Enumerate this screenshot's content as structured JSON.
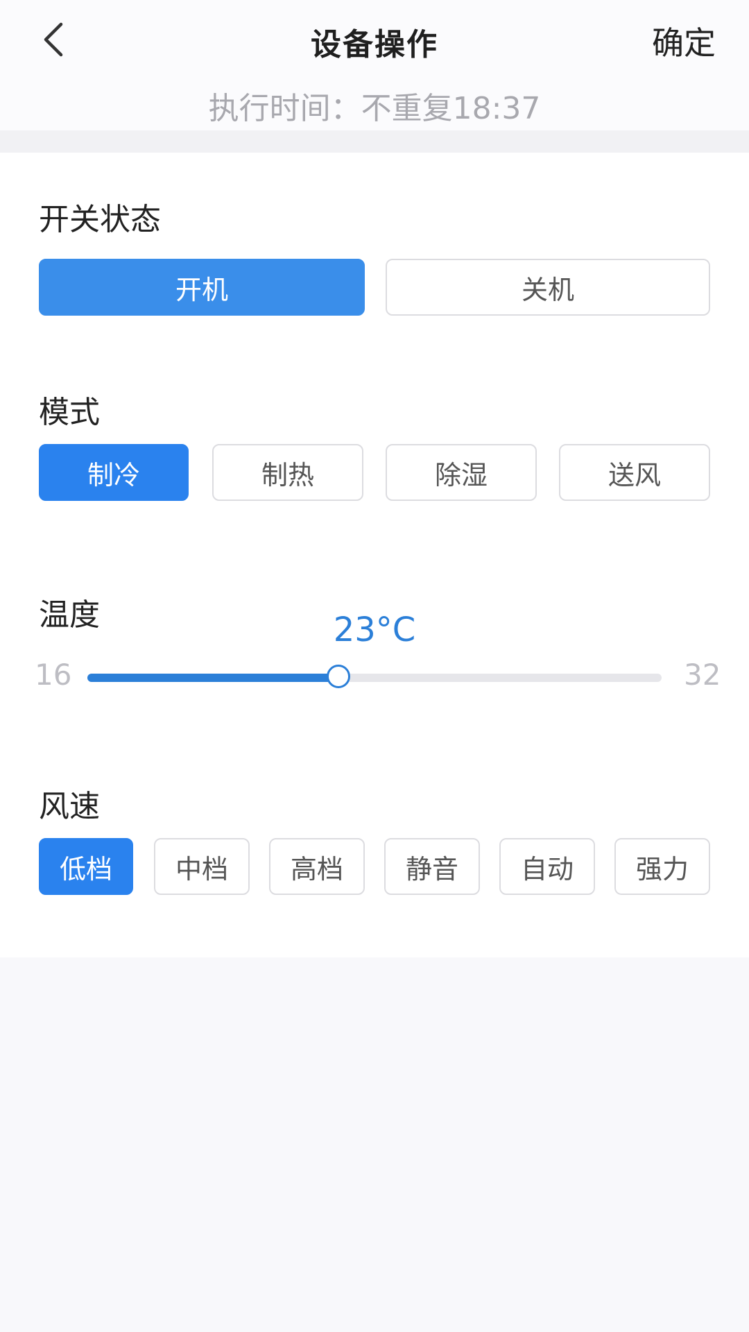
{
  "header": {
    "title": "设备操作",
    "confirm_label": "确定",
    "exec_time": "执行时间：不重复18:37"
  },
  "power": {
    "label": "开关状态",
    "options": [
      "开机",
      "关机"
    ],
    "selected": 0
  },
  "mode": {
    "label": "模式",
    "options": [
      "制冷",
      "制热",
      "除湿",
      "送风"
    ],
    "selected": 0
  },
  "temperature": {
    "label": "温度",
    "value_text": "23°C",
    "value": 23,
    "min": 16,
    "max": 32,
    "min_label": "16",
    "max_label": "32",
    "accent_color": "#2b7fd8"
  },
  "fan": {
    "label": "风速",
    "options": [
      "低档",
      "中档",
      "高档",
      "静音",
      "自动",
      "强力"
    ],
    "selected": 0
  },
  "colors": {
    "primary": "#3a8eea",
    "primary_dark": "#2a82ee"
  },
  "icons": {
    "back": "chevron-left-icon"
  }
}
